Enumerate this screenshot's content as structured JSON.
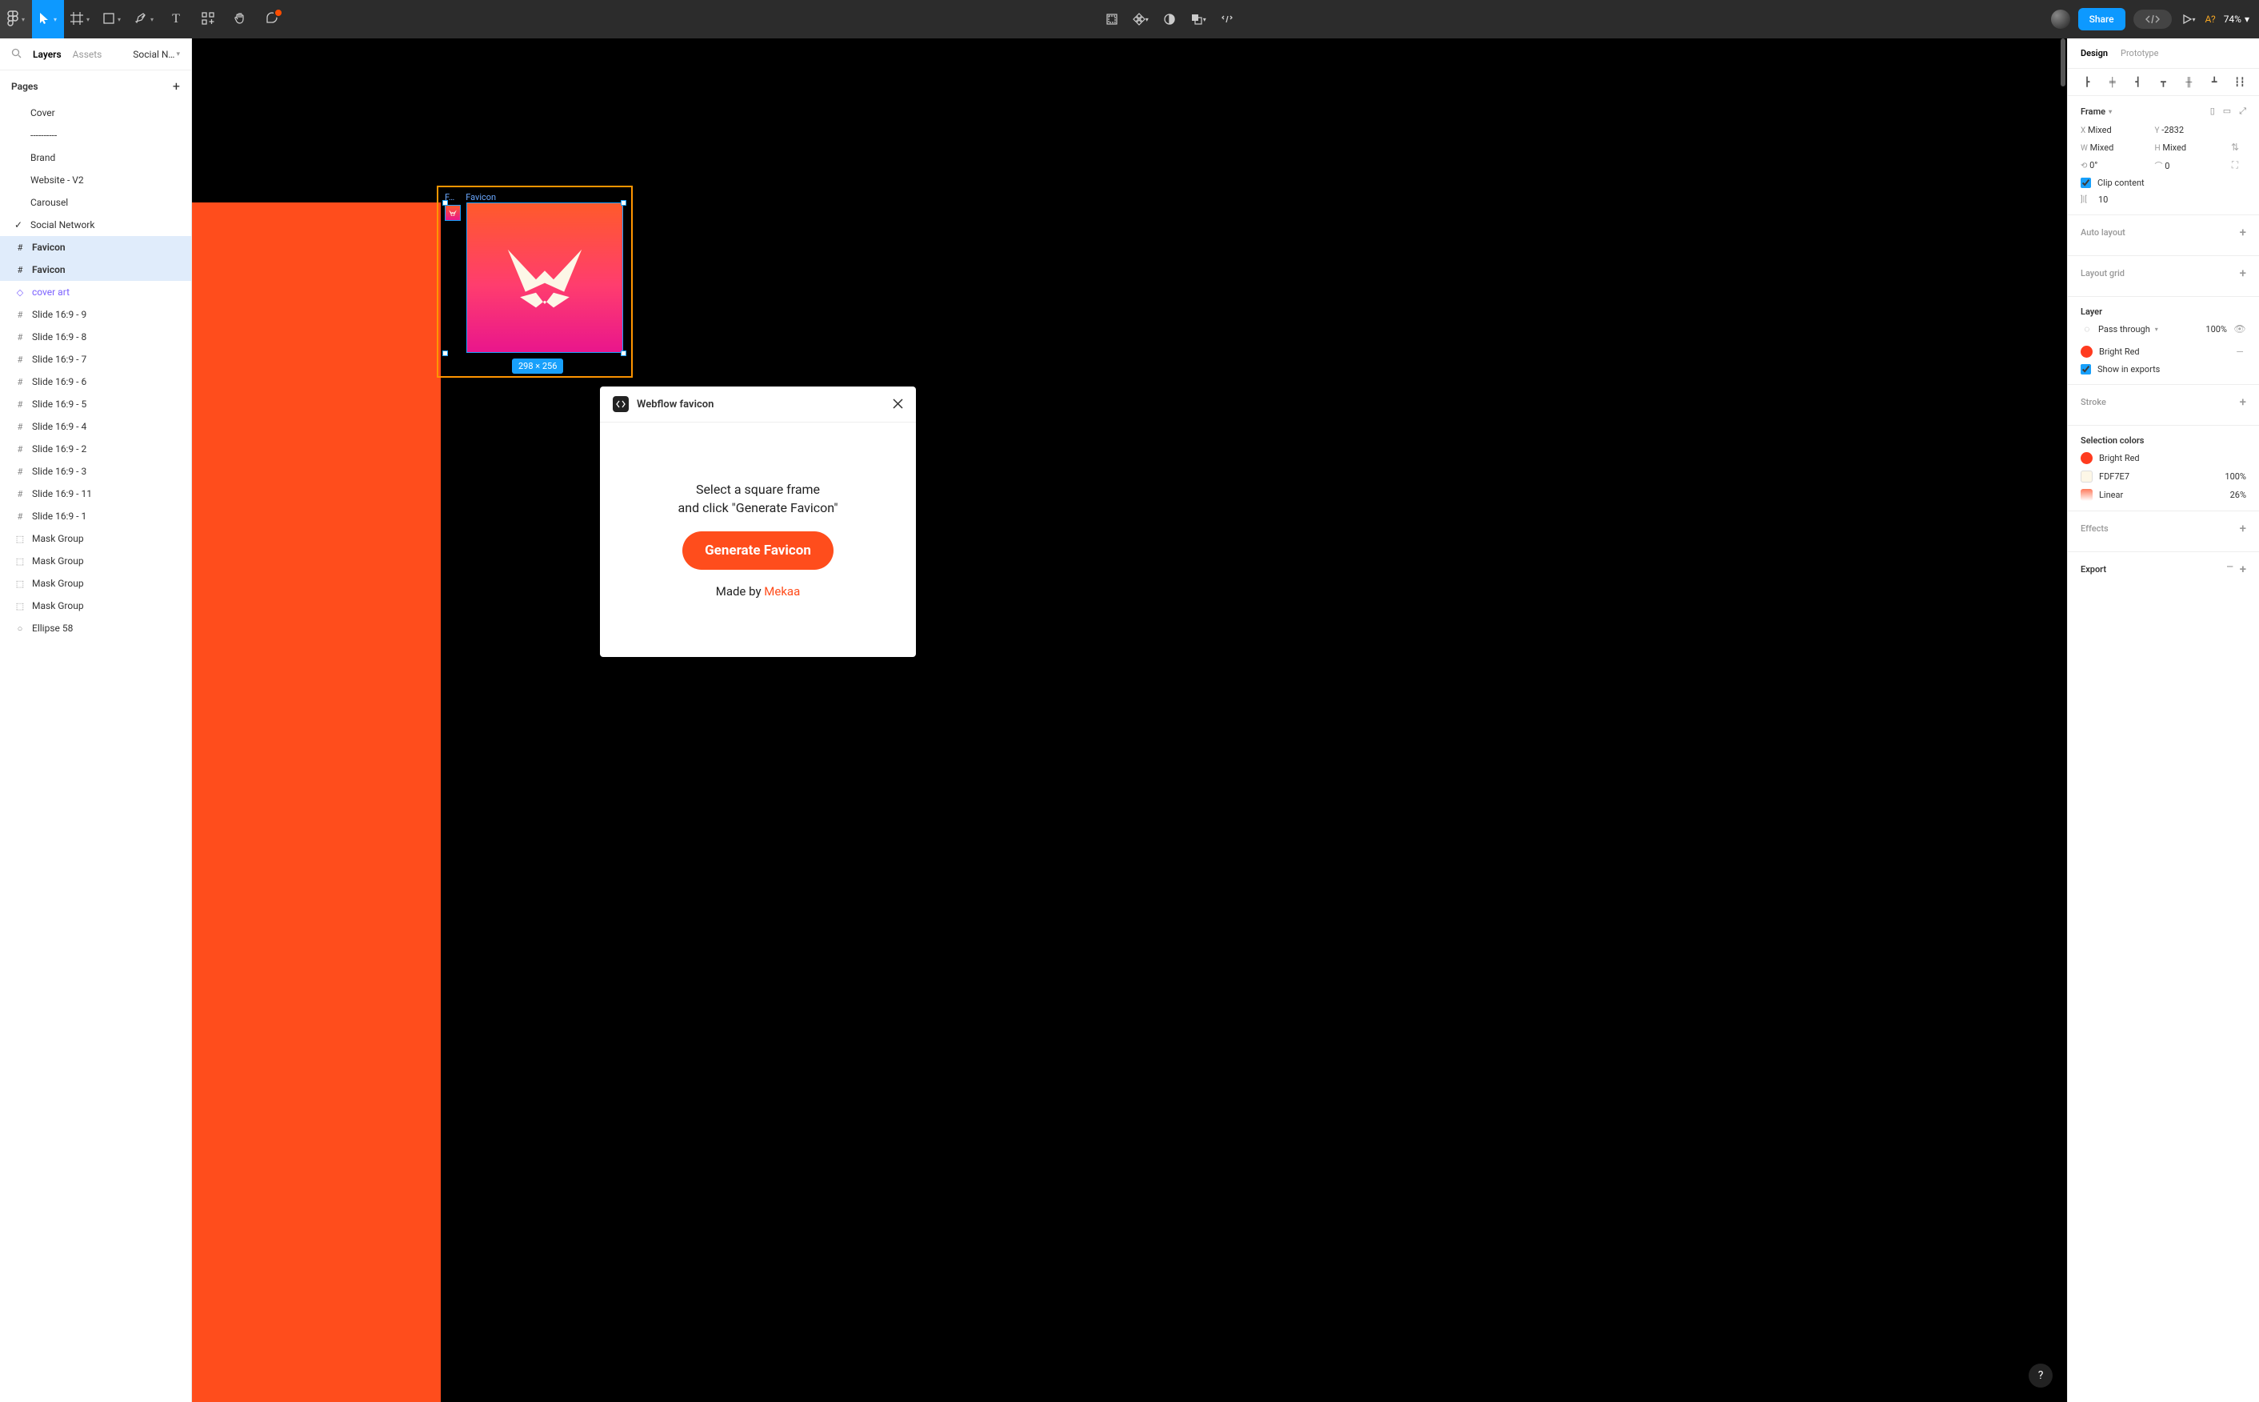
{
  "toolbar": {
    "share_label": "Share",
    "zoom": "74%",
    "aq": "A?"
  },
  "left": {
    "tabs": {
      "layers": "Layers",
      "assets": "Assets",
      "doc": "Social N…"
    },
    "pages_header": "Pages",
    "pages": [
      {
        "label": "Cover"
      },
      {
        "label": "----------"
      },
      {
        "label": "Brand"
      },
      {
        "label": "Website - V2"
      },
      {
        "label": "Carousel"
      },
      {
        "label": "Social Network",
        "checked": true
      }
    ],
    "layers": [
      {
        "icon": "frame",
        "label": "Favicon",
        "sel": true,
        "bold": true
      },
      {
        "icon": "frame",
        "label": "Favicon",
        "sel": true,
        "bold": true
      },
      {
        "icon": "comp",
        "label": "cover art",
        "purple": true
      },
      {
        "icon": "frame",
        "label": "Slide 16:9 - 9"
      },
      {
        "icon": "frame",
        "label": "Slide 16:9 - 8"
      },
      {
        "icon": "frame",
        "label": "Slide 16:9 - 7"
      },
      {
        "icon": "frame",
        "label": "Slide 16:9 - 6"
      },
      {
        "icon": "frame",
        "label": "Slide 16:9 - 5"
      },
      {
        "icon": "frame",
        "label": "Slide 16:9 - 4"
      },
      {
        "icon": "frame",
        "label": "Slide 16:9 - 2"
      },
      {
        "icon": "frame",
        "label": "Slide 16:9 - 3"
      },
      {
        "icon": "frame",
        "label": "Slide 16:9 - 11"
      },
      {
        "icon": "frame",
        "label": "Slide 16:9 - 1"
      },
      {
        "icon": "mask",
        "label": "Mask Group"
      },
      {
        "icon": "mask",
        "label": "Mask Group"
      },
      {
        "icon": "mask",
        "label": "Mask Group"
      },
      {
        "icon": "mask",
        "label": "Mask Group"
      },
      {
        "icon": "ellipse",
        "label": "Ellipse 58"
      }
    ]
  },
  "canvas": {
    "frame_label_small": "F…",
    "frame_label_big": "Favicon",
    "dimensions": "298 × 256"
  },
  "plugin": {
    "title": "Webflow favicon",
    "msg_l1": "Select a square frame",
    "msg_l2": "and click \"Generate Favicon\"",
    "button": "Generate Favicon",
    "credit_pre": "Made by ",
    "credit_link": "Mekaa"
  },
  "right": {
    "tabs": {
      "design": "Design",
      "prototype": "Prototype"
    },
    "frame": {
      "title": "Frame",
      "x_lbl": "X",
      "x_val": "Mixed",
      "y_lbl": "Y",
      "y_val": "-2832",
      "w_lbl": "W",
      "w_val": "Mixed",
      "h_lbl": "H",
      "h_val": "Mixed",
      "rot_val": "0°",
      "rad_val": "0",
      "clip_label": "Clip content",
      "gap_val": "10"
    },
    "auto_layout": "Auto layout",
    "layout_grid": "Layout grid",
    "layer": {
      "title": "Layer",
      "blend": "Pass through",
      "opacity": "100%",
      "fill_name": "Bright Red",
      "show_exports": "Show in exports"
    },
    "stroke": "Stroke",
    "selection_colors": {
      "title": "Selection colors",
      "items": [
        {
          "swatch": "red",
          "label": "Bright Red",
          "pct": ""
        },
        {
          "swatch": "cream",
          "label": "FDF7E7",
          "pct": "100%"
        },
        {
          "swatch": "grad",
          "label": "Linear",
          "pct": "26%"
        }
      ]
    },
    "effects": "Effects",
    "export": "Export"
  },
  "help": "?"
}
